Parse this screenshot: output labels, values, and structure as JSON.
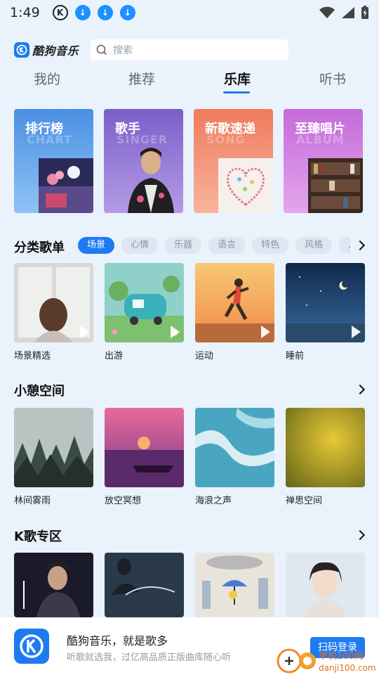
{
  "status_bar": {
    "time": "1:49"
  },
  "header": {
    "brand": "酷狗音乐",
    "search_placeholder": "搜索"
  },
  "tabs": [
    {
      "label": "我的"
    },
    {
      "label": "推荐"
    },
    {
      "label": "乐库",
      "active": true
    },
    {
      "label": "听书"
    }
  ],
  "feature_cards": [
    {
      "label": "排行榜",
      "ghost": "CHART"
    },
    {
      "label": "歌手",
      "ghost": "SINGER"
    },
    {
      "label": "新歌速递",
      "ghost": "SONG"
    },
    {
      "label": "至臻唱片",
      "ghost": "ALBUM"
    }
  ],
  "categories": {
    "title": "分类歌单",
    "chips": [
      "场景",
      "心情",
      "乐器",
      "语言",
      "特色",
      "风格",
      "儿"
    ],
    "selected": "场景",
    "playlists": [
      {
        "label": "场景精选"
      },
      {
        "label": "出游"
      },
      {
        "label": "运动"
      },
      {
        "label": "睡前"
      }
    ]
  },
  "relax": {
    "title": "小憩空间",
    "items": [
      {
        "label": "林间雾雨"
      },
      {
        "label": "放空冥想"
      },
      {
        "label": "海浪之声"
      },
      {
        "label": "禅思空间"
      }
    ]
  },
  "karaoke": {
    "title": "K歌专区"
  },
  "install_banner": {
    "title": "酷狗音乐，就是歌多",
    "subtitle": "听歌就选我，过亿高品质正版曲库随心听",
    "button": "扫码登录"
  },
  "watermark": {
    "text": "单机100网",
    "url": "danji100.com"
  },
  "colors": {
    "accent": "#1d7bf2",
    "background": "#eaf2fc"
  }
}
